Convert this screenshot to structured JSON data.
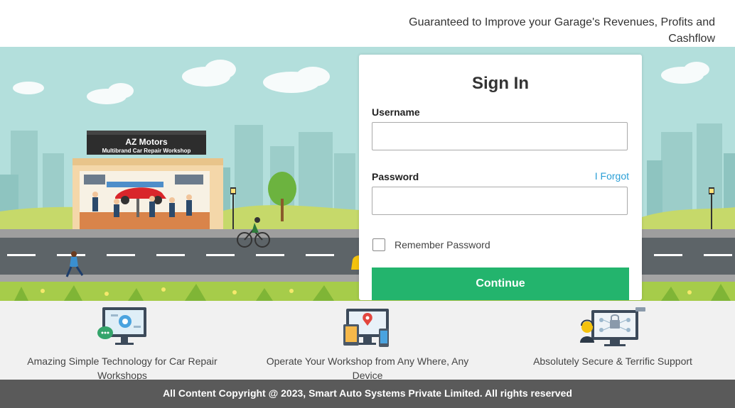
{
  "header": {
    "tagline": "Guaranteed to Improve your Garage's Revenues, Profits and Cashflow"
  },
  "hero": {
    "shop_name": "AZ Motors",
    "shop_subtitle": "Multibrand Car Repair Workshop"
  },
  "signin": {
    "title": "Sign In",
    "username_label": "Username",
    "username_value": "",
    "password_label": "Password",
    "password_value": "",
    "forgot_link": "I Forgot",
    "remember_label": "Remember Password",
    "remember_checked": false,
    "continue_label": "Continue"
  },
  "features": [
    {
      "icon": "monitor-chat-icon",
      "text": "Amazing Simple Technology for Car Repair Workshops"
    },
    {
      "icon": "multi-device-location-icon",
      "text": "Operate Your Workshop from Any Where, Any Device"
    },
    {
      "icon": "secure-support-icon",
      "text": "Absolutely Secure & Terrific Support"
    }
  ],
  "footer": {
    "copyright": "All Content Copyright @ 2023, Smart Auto Systems Private Limited. All rights reserved"
  },
  "colors": {
    "accent_green": "#23b46d",
    "link_blue": "#2a9fd6",
    "footer_gray": "#5a5a5a",
    "sky": "#b3dfdc"
  }
}
